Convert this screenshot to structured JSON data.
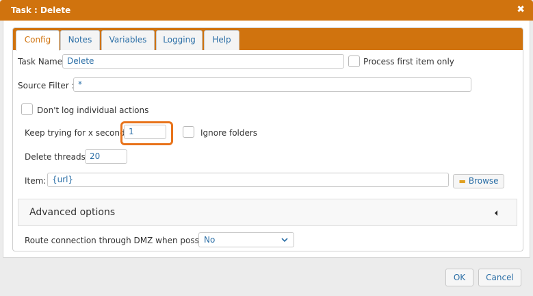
{
  "window": {
    "title": "Task : Delete",
    "close_glyph": "✖"
  },
  "tabs": [
    {
      "label": "Config",
      "active": true
    },
    {
      "label": "Notes"
    },
    {
      "label": "Variables"
    },
    {
      "label": "Logging"
    },
    {
      "label": "Help"
    }
  ],
  "form": {
    "task_name_label": "Task Name:",
    "task_name_value": "Delete",
    "process_first_label": "Process first item only",
    "source_filter_label": "Source Filter :",
    "source_filter_value": "*",
    "dont_log_label": "Don't log individual actions",
    "keep_trying_label": "Keep trying for x seconds:",
    "keep_trying_value": "1",
    "ignore_folders_label": "Ignore folders",
    "delete_threads_label": "Delete threads:",
    "delete_threads_value": "20",
    "item_label": "Item:",
    "item_value": "{url}",
    "browse_label": "Browse",
    "advanced_label": "Advanced options",
    "route_label": "Route connection through DMZ when possible:",
    "route_value": "No"
  },
  "footer": {
    "ok_label": "OK",
    "cancel_label": "Cancel"
  },
  "colors": {
    "accent": "#d0730e",
    "link": "#2a6ea6",
    "highlight": "#e8731b"
  },
  "icons": {
    "close": "close-icon",
    "browse": "folder-icon",
    "advanced": "caret-left-icon",
    "select": "chevron-down-icon"
  }
}
